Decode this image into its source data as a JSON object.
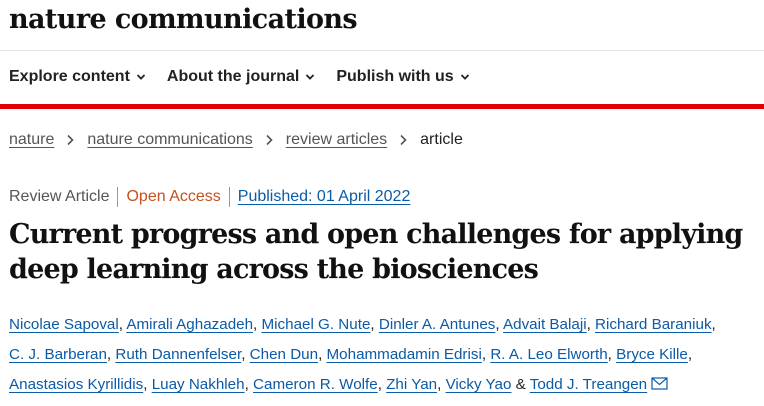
{
  "brand": {
    "name": "nature communications"
  },
  "nav": [
    {
      "label": "Explore content"
    },
    {
      "label": "About the journal"
    },
    {
      "label": "Publish with us"
    }
  ],
  "breadcrumb": {
    "items": [
      "nature",
      "nature communications",
      "review articles"
    ],
    "current": "article"
  },
  "article": {
    "type": "Review Article",
    "access": "Open Access",
    "published": "Published: 01 April 2022",
    "title": "Current progress and open challenges for applying deep learning across the biosciences"
  },
  "authors": {
    "list": [
      "Nicolae Sapoval",
      "Amirali Aghazadeh",
      "Michael G. Nute",
      "Dinler A. Antunes",
      "Advait Balaji",
      "Richard Baraniuk",
      "C. J. Barberan",
      "Ruth Dannenfelser",
      "Chen Dun",
      "Mohammadamin Edrisi",
      "R. A. Leo Elworth",
      "Bryce Kille",
      "Anastasios Kyrillidis",
      "Luay Nakhleh",
      "Cameron R. Wolfe",
      "Zhi Yan",
      "Vicky Yao",
      "Todd J. Treangen"
    ],
    "comma": ",",
    "ampersand": "&"
  },
  "colors": {
    "accent_red": "#e00000",
    "link_blue": "#0b5aa5",
    "open_access": "#c4501d"
  },
  "icons": {
    "nav_chevron": "chevron-down-icon",
    "breadcrumb_sep": "chevron-right-icon",
    "contact": "mail-icon"
  }
}
